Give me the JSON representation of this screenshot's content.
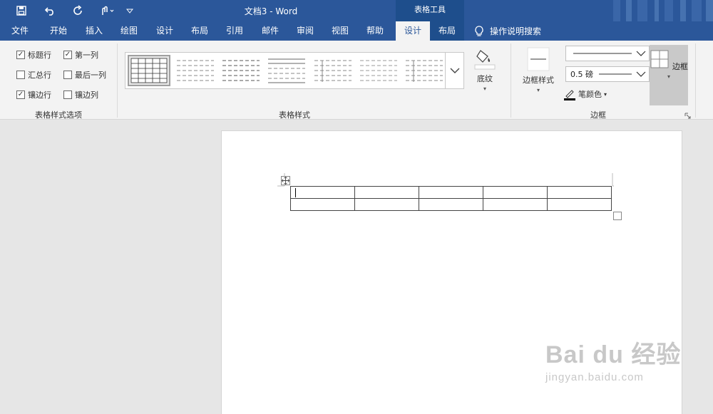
{
  "window": {
    "title": "文档3  -  Word",
    "contextual_group": "表格工具"
  },
  "tabs": [
    {
      "label": "文件"
    },
    {
      "label": "开始"
    },
    {
      "label": "插入"
    },
    {
      "label": "绘图"
    },
    {
      "label": "设计"
    },
    {
      "label": "布局"
    },
    {
      "label": "引用"
    },
    {
      "label": "邮件"
    },
    {
      "label": "审阅"
    },
    {
      "label": "视图"
    },
    {
      "label": "帮助"
    },
    {
      "label": "设计",
      "active": true
    },
    {
      "label": "布局"
    }
  ],
  "search": {
    "label": "操作说明搜索",
    "icon": "lightbulb-icon"
  },
  "quick_access": [
    {
      "icon": "save-icon"
    },
    {
      "icon": "undo-icon"
    },
    {
      "icon": "redo-icon"
    },
    {
      "icon": "touch-mode-icon"
    },
    {
      "icon": "customize-dropdown-icon"
    }
  ],
  "style_options": {
    "label": "表格样式选项",
    "items": [
      {
        "label": "标题行",
        "checked": true
      },
      {
        "label": "第一列",
        "checked": true
      },
      {
        "label": "汇总行",
        "checked": false
      },
      {
        "label": "最后一列",
        "checked": false
      },
      {
        "label": "镶边行",
        "checked": true
      },
      {
        "label": "镶边列",
        "checked": false
      }
    ]
  },
  "table_styles": {
    "label": "表格样式",
    "thumbnail_count": 7
  },
  "shading": {
    "label": "底纹"
  },
  "borders_group": {
    "label": "边框",
    "border_styles_label": "边框样式",
    "weight_value": "0.5 磅",
    "pen_color_label": "笔颜色",
    "borders_label": "边框"
  },
  "colors": {
    "accent": "#2b579a",
    "contextual": "#1e4e8c",
    "ribbon": "#f3f3f3"
  },
  "document": {
    "table": {
      "rows": 2,
      "cols": 5
    }
  },
  "watermark": {
    "brand": "Bai du 经验",
    "url": "jingyan.baidu.com"
  }
}
